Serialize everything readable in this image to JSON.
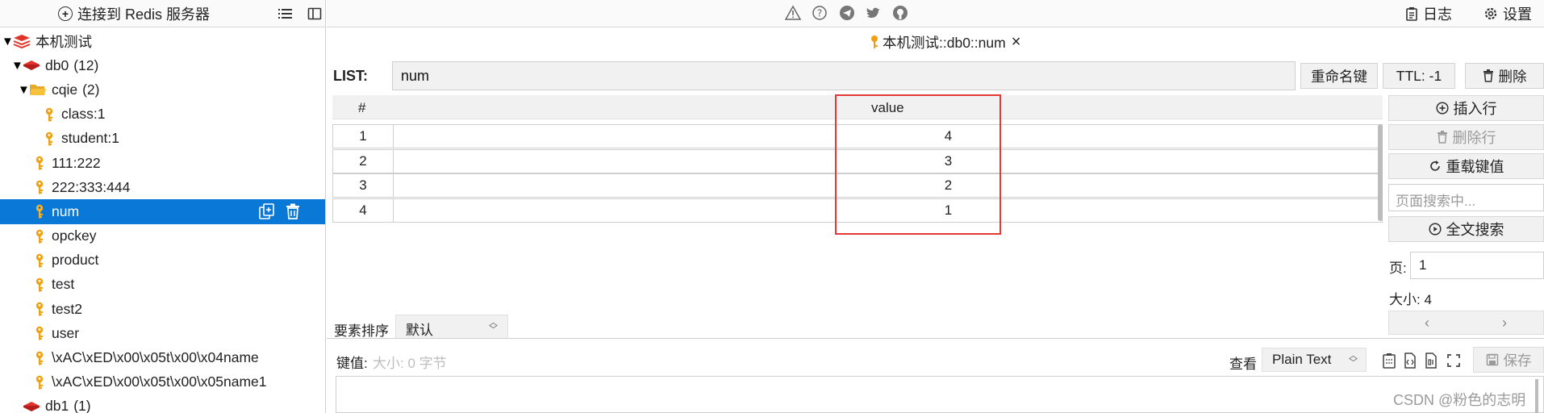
{
  "sidebar": {
    "connect_label": "连接到 Redis 服务器",
    "tree": [
      {
        "label": "本机测试",
        "level": 0,
        "kind": "server",
        "expanded": true
      },
      {
        "label": "db0",
        "count": "(12)",
        "level": 1,
        "kind": "db",
        "expanded": true
      },
      {
        "label": "cqie",
        "count": "(2)",
        "level": 2,
        "kind": "folder",
        "expanded": true
      },
      {
        "label": "class:1",
        "level": 4,
        "kind": "key"
      },
      {
        "label": "student:1",
        "level": 4,
        "kind": "key"
      },
      {
        "label": "111:222",
        "level": 3,
        "kind": "key"
      },
      {
        "label": "222:333:444",
        "level": 3,
        "kind": "key"
      },
      {
        "label": "num",
        "level": 3,
        "kind": "key",
        "selected": true
      },
      {
        "label": "opckey",
        "level": 3,
        "kind": "key"
      },
      {
        "label": "product",
        "level": 3,
        "kind": "key"
      },
      {
        "label": "test",
        "level": 3,
        "kind": "key"
      },
      {
        "label": "test2",
        "level": 3,
        "kind": "key"
      },
      {
        "label": "user",
        "level": 3,
        "kind": "key"
      },
      {
        "label": "\\xAC\\xED\\x00\\x05t\\x00\\x04name",
        "level": 3,
        "kind": "key"
      },
      {
        "label": "\\xAC\\xED\\x00\\x05t\\x00\\x05name1",
        "level": 3,
        "kind": "key"
      },
      {
        "label": "db1",
        "count": "(1)",
        "level": 1,
        "kind": "db",
        "expanded": false
      }
    ],
    "row_actions": [
      "copy-icon",
      "trash-icon"
    ]
  },
  "topbar": {
    "icons": [
      "warning-icon",
      "help-icon",
      "telegram-icon",
      "twitter-icon",
      "github-icon"
    ],
    "log_label": "日志",
    "settings_label": "设置"
  },
  "tab": {
    "title": "本机测试::db0::num"
  },
  "key": {
    "type_label": "LIST:",
    "name": "num",
    "rename_label": "重命名键",
    "ttl_label": "TTL: -1",
    "delete_label": "删除"
  },
  "table": {
    "headers": [
      "#",
      "value"
    ],
    "rows": [
      {
        "index": "1",
        "value": "4"
      },
      {
        "index": "2",
        "value": "3"
      },
      {
        "index": "3",
        "value": "2"
      },
      {
        "index": "4",
        "value": "1"
      }
    ]
  },
  "right_panel": {
    "insert_row": "插入行",
    "delete_row": "删除行",
    "reload": "重载键值",
    "search_placeholder": "页面搜索中...",
    "fulltext_search": "全文搜索",
    "page_label": "页:",
    "page_value": "1",
    "size_label": "大小: 4",
    "prev": "‹",
    "next": "›"
  },
  "editor": {
    "sort_label": "要素排序",
    "sort_value": "默认",
    "keyval_label": "键值:",
    "keyval_size": "大小: 0 字节",
    "view_label": "查看",
    "view_value": "Plain Text",
    "save_label": "保存"
  },
  "watermark": "CSDN @粉色的志明",
  "colors": {
    "selection": "#0a78d7",
    "key_icon": "#f0a010",
    "db_icon": "#e0342a",
    "folder_icon": "#f6c23c",
    "highlight_box": "#e53935"
  }
}
